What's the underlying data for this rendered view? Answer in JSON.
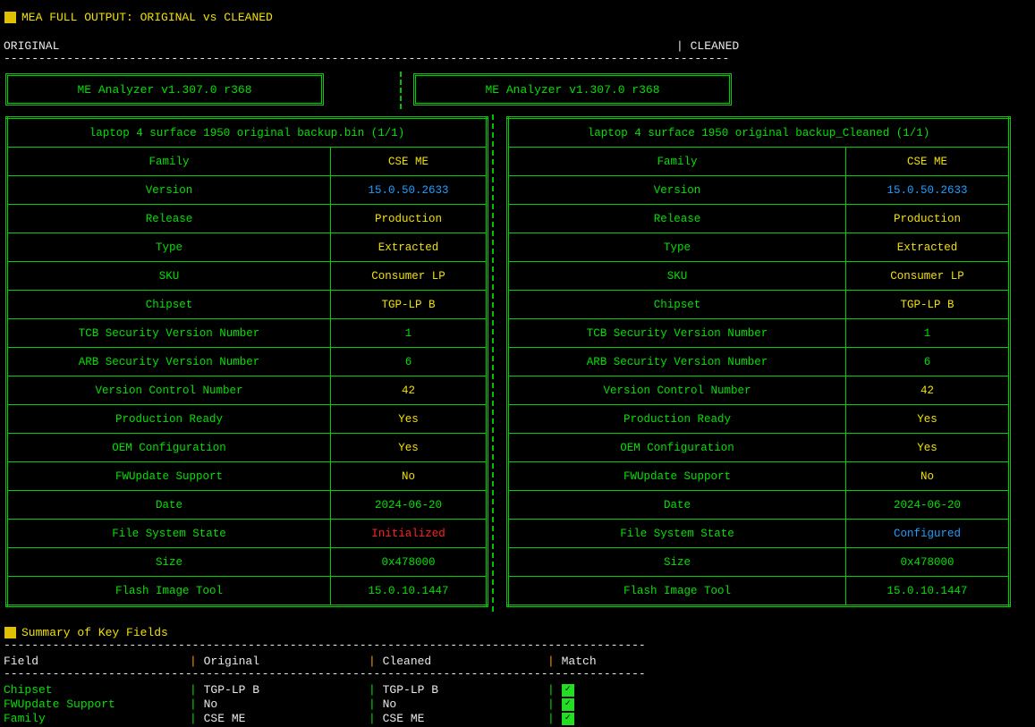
{
  "title": "MEA FULL OUTPUT: ORIGINAL vs CLEANED",
  "original_label": "ORIGINAL",
  "cleaned_label": "| CLEANED",
  "analyzer": "ME Analyzer v1.307.0 r368",
  "left": {
    "file": "laptop 4 surface 1950 original backup.bin (1/1)",
    "rows": [
      [
        "Family",
        "CSE ME",
        "y"
      ],
      [
        "Version",
        "15.0.50.2633",
        "b"
      ],
      [
        "Release",
        "Production",
        "y"
      ],
      [
        "Type",
        "Extracted",
        "y"
      ],
      [
        "SKU",
        "Consumer LP",
        "y"
      ],
      [
        "Chipset",
        "TGP-LP B",
        "y"
      ],
      [
        "TCB Security Version Number",
        "1",
        "g"
      ],
      [
        "ARB Security Version Number",
        "6",
        "g"
      ],
      [
        "Version Control Number",
        "42",
        "y"
      ],
      [
        "Production Ready",
        "Yes",
        "y"
      ],
      [
        "OEM Configuration",
        "Yes",
        "y"
      ],
      [
        "FWUpdate Support",
        "No",
        "y"
      ],
      [
        "Date",
        "2024-06-20",
        "g"
      ],
      [
        "File System State",
        "Initialized",
        "r"
      ],
      [
        "Size",
        "0x478000",
        "g"
      ],
      [
        "Flash Image Tool",
        "15.0.10.1447",
        "g"
      ]
    ]
  },
  "right": {
    "file": "laptop 4 surface 1950 original backup_Cleaned (1/1)",
    "rows": [
      [
        "Family",
        "CSE ME",
        "y"
      ],
      [
        "Version",
        "15.0.50.2633",
        "b"
      ],
      [
        "Release",
        "Production",
        "y"
      ],
      [
        "Type",
        "Extracted",
        "y"
      ],
      [
        "SKU",
        "Consumer LP",
        "y"
      ],
      [
        "Chipset",
        "TGP-LP B",
        "y"
      ],
      [
        "TCB Security Version Number",
        "1",
        "g"
      ],
      [
        "ARB Security Version Number",
        "6",
        "g"
      ],
      [
        "Version Control Number",
        "42",
        "y"
      ],
      [
        "Production Ready",
        "Yes",
        "y"
      ],
      [
        "OEM Configuration",
        "Yes",
        "y"
      ],
      [
        "FWUpdate Support",
        "No",
        "y"
      ],
      [
        "Date",
        "2024-06-20",
        "g"
      ],
      [
        "File System State",
        "Configured",
        "b"
      ],
      [
        "Size",
        "0x478000",
        "g"
      ],
      [
        "Flash Image Tool",
        "15.0.10.1447",
        "g"
      ]
    ]
  },
  "summary": {
    "title": "Summary of Key Fields",
    "headers": [
      "Field",
      "Original",
      "Cleaned",
      "Match"
    ],
    "rows": [
      [
        "Chipset",
        "TGP-LP B",
        "TGP-LP B",
        "✓"
      ],
      [
        "FWUpdate Support",
        "No",
        "No",
        "✓"
      ],
      [
        "Family",
        "CSE ME",
        "CSE ME",
        "✓"
      ]
    ]
  }
}
